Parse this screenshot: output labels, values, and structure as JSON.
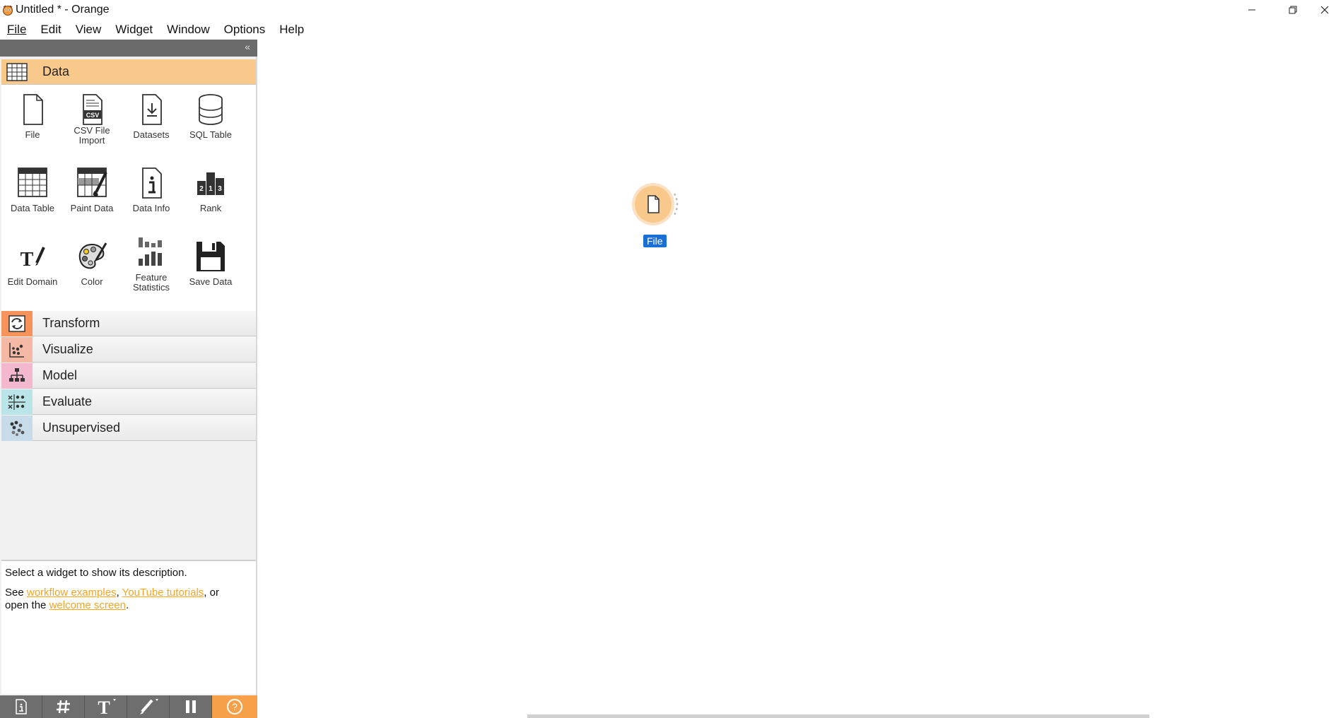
{
  "window": {
    "title": "Untitled * - Orange",
    "controls": [
      "minimize-icon",
      "restore-icon",
      "close-icon"
    ]
  },
  "menu": [
    {
      "label": "File",
      "mnemonic": "F"
    },
    {
      "label": "Edit",
      "mnemonic": "E"
    },
    {
      "label": "View",
      "mnemonic": "V"
    },
    {
      "label": "Widget",
      "mnemonic": "W"
    },
    {
      "label": "Window",
      "mnemonic": ""
    },
    {
      "label": "Options",
      "mnemonic": "O"
    },
    {
      "label": "Help",
      "mnemonic": "H"
    }
  ],
  "panel": {
    "collapse_glyph": "«",
    "categories": [
      {
        "label": "Data",
        "color": "#f9c98c",
        "expanded": true
      },
      {
        "label": "Transform",
        "color": "#f5935a"
      },
      {
        "label": "Visualize",
        "color": "#f4b8a4"
      },
      {
        "label": "Model",
        "color": "#f3b7cf"
      },
      {
        "label": "Evaluate",
        "color": "#b9e5e8"
      },
      {
        "label": "Unsupervised",
        "color": "#c8dbe8"
      }
    ],
    "data_widgets": [
      {
        "label": "File",
        "icon": "file-icon"
      },
      {
        "label": "CSV File Import",
        "icon": "csv-icon"
      },
      {
        "label": "Datasets",
        "icon": "datasets-icon"
      },
      {
        "label": "SQL Table",
        "icon": "database-icon"
      },
      {
        "label": "Data Table",
        "icon": "table-icon"
      },
      {
        "label": "Paint Data",
        "icon": "paint-icon"
      },
      {
        "label": "Data Info",
        "icon": "info-icon"
      },
      {
        "label": "Rank",
        "icon": "rank-icon"
      },
      {
        "label": "Edit Domain",
        "icon": "edit-domain-icon"
      },
      {
        "label": "Color",
        "icon": "palette-icon"
      },
      {
        "label": "Feature Statistics",
        "icon": "feature-stats-icon"
      },
      {
        "label": "Save Data",
        "icon": "save-icon"
      }
    ]
  },
  "description": {
    "line1": "Select a widget to show its description.",
    "see": "See ",
    "link_examples": "workflow examples",
    "comma": ", ",
    "link_tutorials": "YouTube tutorials",
    "or": ", or",
    "open_the": "open the ",
    "link_welcome": "welcome screen",
    "period": "."
  },
  "toolbar": {
    "buttons": [
      "info-icon",
      "grid-icon",
      "text-annotation-icon",
      "arrow-annotation-icon",
      "pause-icon",
      "help-icon"
    ]
  },
  "canvas": {
    "node": {
      "label": "File",
      "icon": "file-icon",
      "color": "#f9c98c"
    }
  },
  "colors": {
    "accent": "#f7a04a",
    "selection": "#1a6fd6",
    "link": "#f5a623"
  }
}
